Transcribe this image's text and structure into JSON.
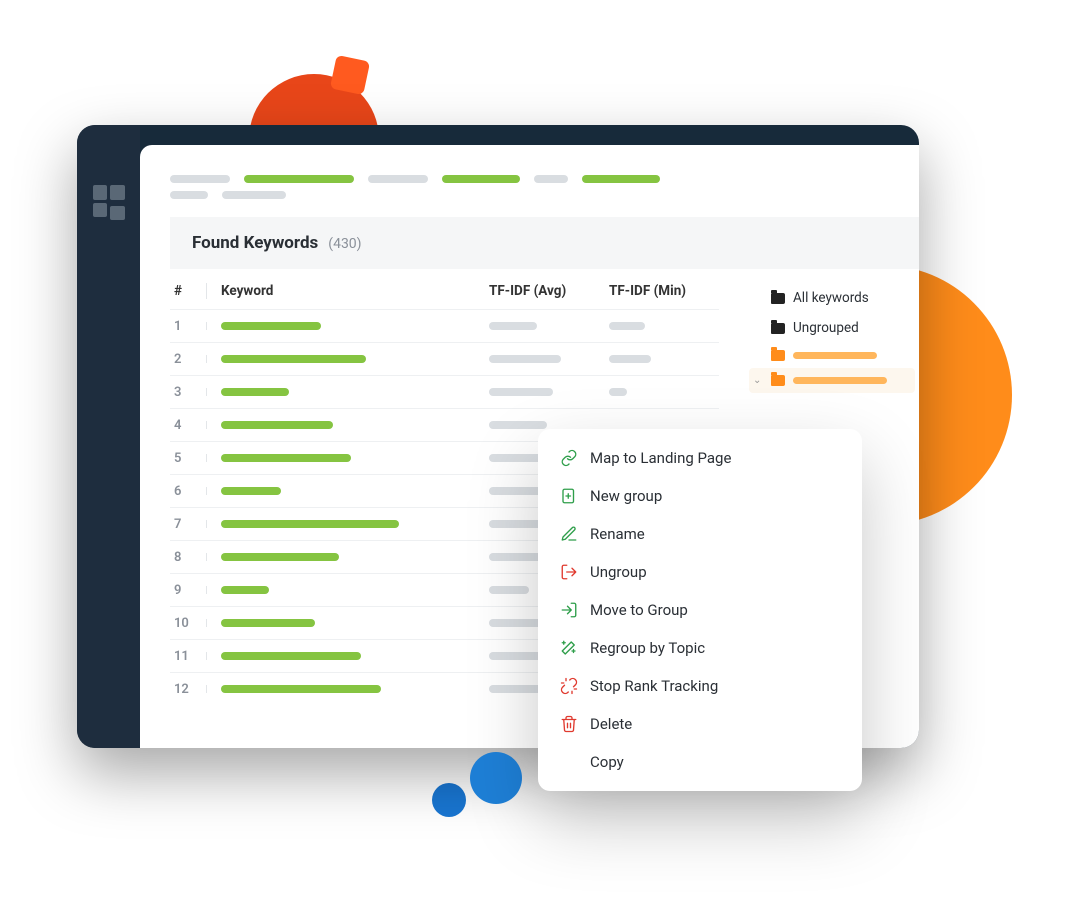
{
  "panel": {
    "title": "Found Keywords",
    "count": "(430)"
  },
  "columns": {
    "num": "#",
    "keyword": "Keyword",
    "avg": "TF-IDF (Avg)",
    "min": "TF-IDF (Min)"
  },
  "rows": [
    {
      "n": "1",
      "kw": 100,
      "avg": 48,
      "min": 36
    },
    {
      "n": "2",
      "kw": 145,
      "avg": 72,
      "min": 42
    },
    {
      "n": "3",
      "kw": 68,
      "avg": 64,
      "min": 18
    },
    {
      "n": "4",
      "kw": 112,
      "avg": 58,
      "min": 0
    },
    {
      "n": "5",
      "kw": 130,
      "avg": 86,
      "min": 0
    },
    {
      "n": "6",
      "kw": 60,
      "avg": 70,
      "min": 0
    },
    {
      "n": "7",
      "kw": 178,
      "avg": 92,
      "min": 0
    },
    {
      "n": "8",
      "kw": 118,
      "avg": 54,
      "min": 0
    },
    {
      "n": "9",
      "kw": 48,
      "avg": 40,
      "min": 0
    },
    {
      "n": "10",
      "kw": 94,
      "avg": 66,
      "min": 0
    },
    {
      "n": "11",
      "kw": 140,
      "avg": 60,
      "min": 0
    },
    {
      "n": "12",
      "kw": 160,
      "avg": 76,
      "min": 0
    }
  ],
  "groups": {
    "all": "All keywords",
    "ungrouped": "Ungrouped"
  },
  "menu": {
    "map": "Map to Landing Page",
    "new_group": "New group",
    "rename": "Rename",
    "ungroup": "Ungroup",
    "move": "Move to Group",
    "regroup": "Regroup by Topic",
    "stop": "Stop Rank Tracking",
    "delete": "Delete",
    "copy": "Copy"
  }
}
